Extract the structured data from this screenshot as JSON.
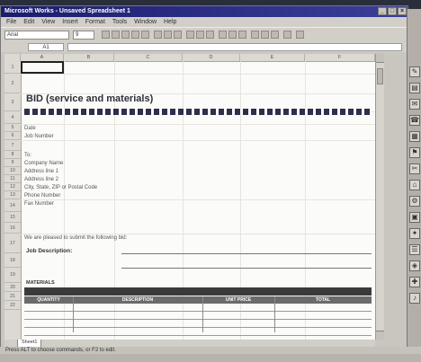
{
  "window": {
    "title": "Microsoft Works - Unsaved Spreadsheet 1"
  },
  "menu": [
    "File",
    "Edit",
    "View",
    "Insert",
    "Format",
    "Tools",
    "Window",
    "Help"
  ],
  "toolbar": {
    "font": "Arial",
    "size": "9"
  },
  "formula": {
    "cell_ref": "A1"
  },
  "columns": [
    "A",
    "B",
    "C",
    "D",
    "E",
    "F"
  ],
  "rows": [
    "1",
    "2",
    "3",
    "4",
    "5",
    "6",
    "7",
    "8",
    "9",
    "10",
    "11",
    "12",
    "13",
    "14",
    "15",
    "16",
    "17",
    "18",
    "19",
    "20",
    "21",
    "22"
  ],
  "sheet": {
    "title": "BID (service and materials)",
    "labels": {
      "date": "Date",
      "job_number": "Job Number",
      "to": "To:",
      "company_name": "Company Name",
      "address1": "Address line 1",
      "address2": "Address line 2",
      "city": "City, State, ZIP or Postal Code",
      "phone": "Phone Number",
      "fax": "Fax Number",
      "pleased": "We are pleased to submit the following bid:",
      "job_description": "Job Description:",
      "materials": "MATERIALS"
    },
    "table_headers": [
      "QUANTITY",
      "DESCRIPTION",
      "UNIT PRICE",
      "TOTAL"
    ]
  },
  "sheet_tab": "Sheet1",
  "status": "Press ALT to choose commands, or F2 to edit."
}
